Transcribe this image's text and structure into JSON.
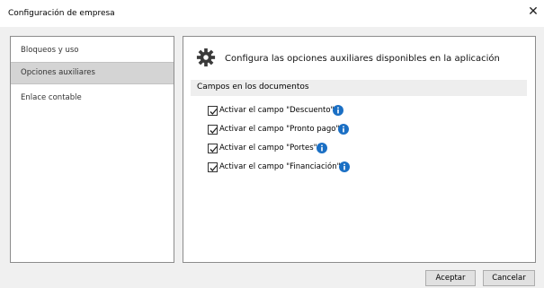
{
  "window": {
    "title": "Configuración de empresa",
    "close_glyph": "✕"
  },
  "sidebar": {
    "items": [
      {
        "label": "Bloqueos y uso",
        "selected": false
      },
      {
        "label": "Opciones auxiliares",
        "selected": true
      },
      {
        "label": "Enlace contable",
        "selected": false
      }
    ]
  },
  "content": {
    "icon": "gear-icon",
    "heading": "Configura las opciones auxiliares disponibles en la aplicación",
    "section": {
      "title": "Campos en los documentos",
      "options": [
        {
          "label": "Activar el campo \"Descuento\"",
          "checked": true,
          "info_icon": "info-icon"
        },
        {
          "label": "Activar el campo \"Pronto pago\"",
          "checked": true,
          "info_icon": "info-icon"
        },
        {
          "label": "Activar el campo \"Portes\"",
          "checked": true,
          "info_icon": "info-icon"
        },
        {
          "label": "Activar el campo \"Financiación\"",
          "checked": true,
          "info_icon": "info-icon"
        }
      ]
    }
  },
  "buttons": {
    "accept": "Aceptar",
    "cancel": "Cancelar"
  },
  "colors": {
    "info_blue": "#1a6fc4",
    "selected_bg": "#d4d4d4",
    "dialog_bg": "#f0f0f0"
  }
}
